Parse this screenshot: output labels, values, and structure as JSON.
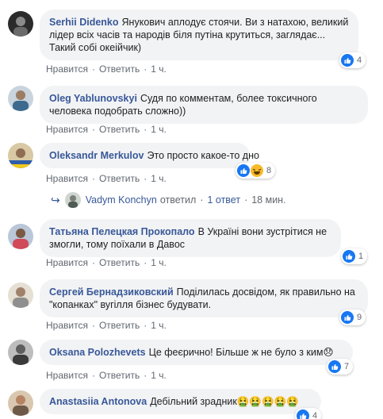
{
  "comments": [
    {
      "author": "Serhii Didenko",
      "text": "Янукович аплодує стоячи. Ви з натахою, великий лідер всіх часів та народів біля путіна крутиться, заглядає... Такий собі океійчик)",
      "like_label": "Нравится",
      "reply_label": "Ответить",
      "time": "1 ч.",
      "reaction_count": "4",
      "reactions": [
        "like-icon"
      ]
    },
    {
      "author": "Oleg Yablunovskyi",
      "text": "Судя по комментам, более токсичного человека подобрать сложно))",
      "like_label": "Нравится",
      "reply_label": "Ответить",
      "time": "1 ч."
    },
    {
      "author": "Oleksandr Merkulov",
      "text": "Это просто какое-то дно",
      "like_label": "Нравится",
      "reply_label": "Ответить",
      "time": "1 ч.",
      "reaction_count": "8",
      "reactions": [
        "like-icon",
        "haha-icon"
      ],
      "reply": {
        "author": "Vadym Konchyn",
        "verb": "ответил",
        "count": "1 ответ",
        "time": "18 мин."
      }
    },
    {
      "author": "Татьяна Пелецкая Прокопало",
      "text": "В Україні вони зустрітися не змогли, тому поїхали в Давос",
      "like_label": "Нравится",
      "reply_label": "Ответить",
      "time": "1 ч.",
      "reaction_count": "1",
      "reactions": [
        "like-icon"
      ]
    },
    {
      "author": "Сергей Бернадзиковский",
      "text": "Поділилась досвідом, як правильно на \"копанках\" вугілля бізнес будувати.",
      "like_label": "Нравится",
      "reply_label": "Ответить",
      "time": "1 ч.",
      "reaction_count": "9",
      "reactions": [
        "like-icon"
      ]
    },
    {
      "author": "Oksana Polozhevets",
      "text": "Це феєрично! Більше ж не було з ким😞",
      "like_label": "Нравится",
      "reply_label": "Ответить",
      "time": "1 ч.",
      "reaction_count": "7",
      "reactions": [
        "like-icon"
      ]
    },
    {
      "author": "Anastasiia Antonova",
      "text": "Дебільний зрадник🤮🤮🤮🤮🤮",
      "like_label": "Нравится",
      "reply_label": "Ответить",
      "time": "1 ч.",
      "reaction_count": "4",
      "reactions": [
        "like-icon"
      ]
    }
  ],
  "colors": {
    "bubble": "#f2f3f5",
    "author": "#385898",
    "meta": "#606770",
    "like_blue": "#1877f2",
    "haha_yellow": "#f7b928"
  }
}
